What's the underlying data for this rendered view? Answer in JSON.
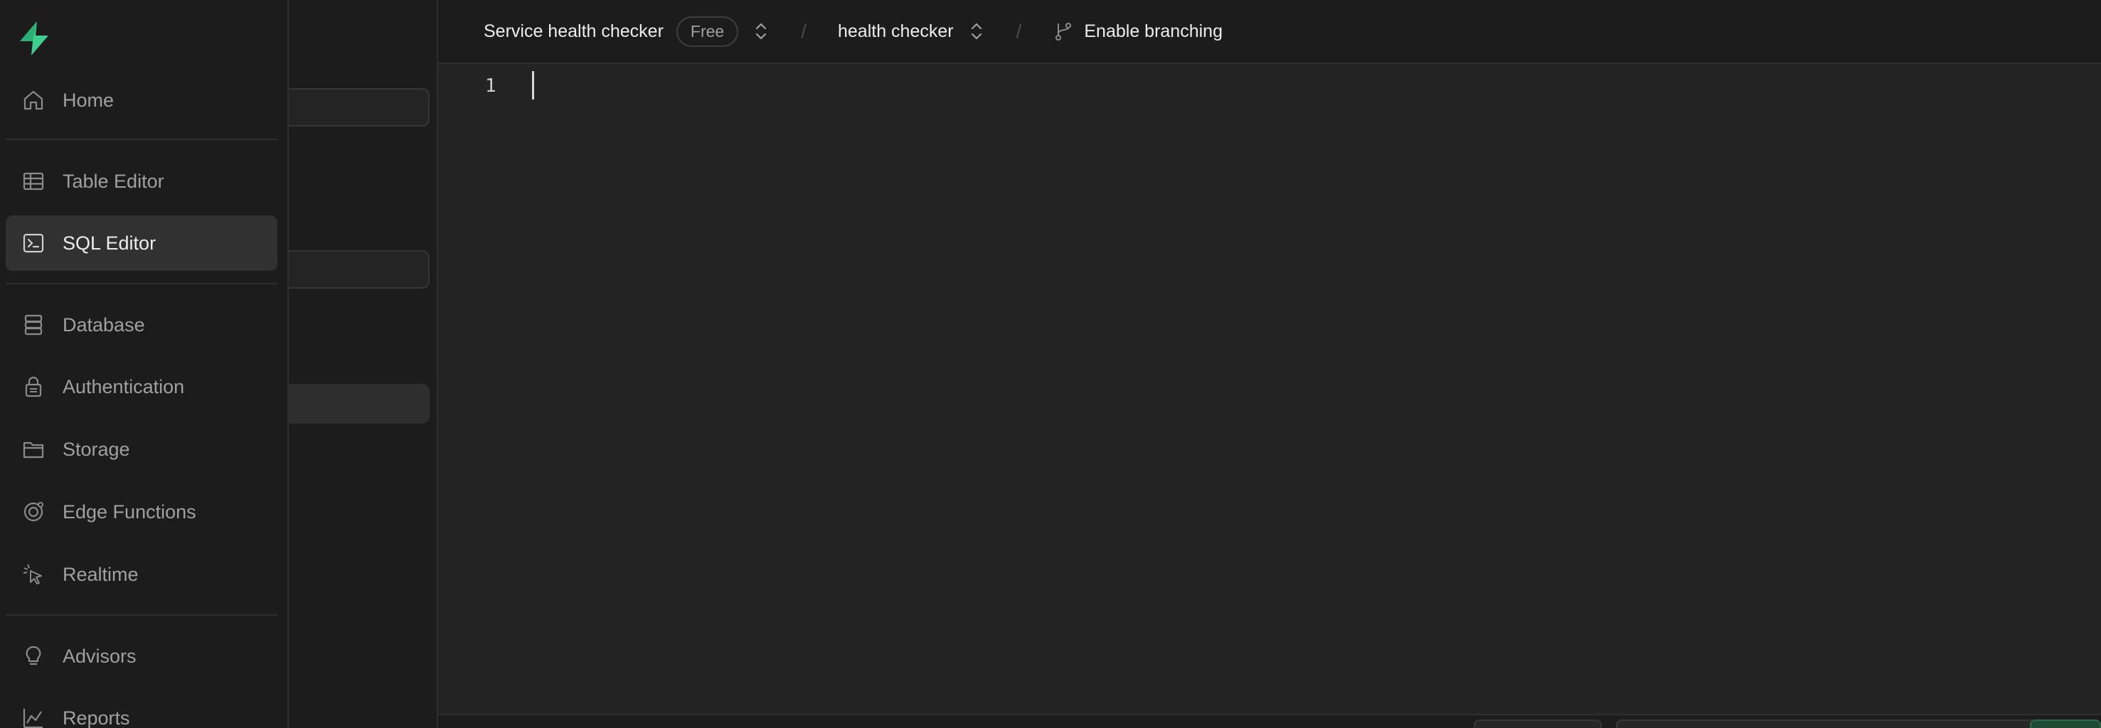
{
  "nav": {
    "items": [
      {
        "label": "Home",
        "icon": "home-icon",
        "active": false
      },
      {
        "label": "Table Editor",
        "icon": "table-icon",
        "active": false
      },
      {
        "label": "SQL Editor",
        "icon": "terminal-icon",
        "active": true
      },
      {
        "label": "Database",
        "icon": "database-icon",
        "active": false
      },
      {
        "label": "Authentication",
        "icon": "lock-icon",
        "active": false
      },
      {
        "label": "Storage",
        "icon": "folder-icon",
        "active": false
      },
      {
        "label": "Edge Functions",
        "icon": "edge-functions-icon",
        "active": false
      },
      {
        "label": "Realtime",
        "icon": "cursor-click-icon",
        "active": false
      },
      {
        "label": "Advisors",
        "icon": "lightbulb-icon",
        "active": false
      },
      {
        "label": "Reports",
        "icon": "chart-icon",
        "active": false
      }
    ]
  },
  "header": {
    "project_name": "Service health checker",
    "plan_badge": "Free",
    "branch_name": "health checker",
    "branching_label": "Enable branching",
    "separator": "/"
  },
  "editor": {
    "line_numbers": [
      "1"
    ]
  },
  "colors": {
    "brand": "#3ecf8e",
    "background": "#1c1c1c",
    "editor_background": "#232323",
    "active_item": "#313131"
  }
}
